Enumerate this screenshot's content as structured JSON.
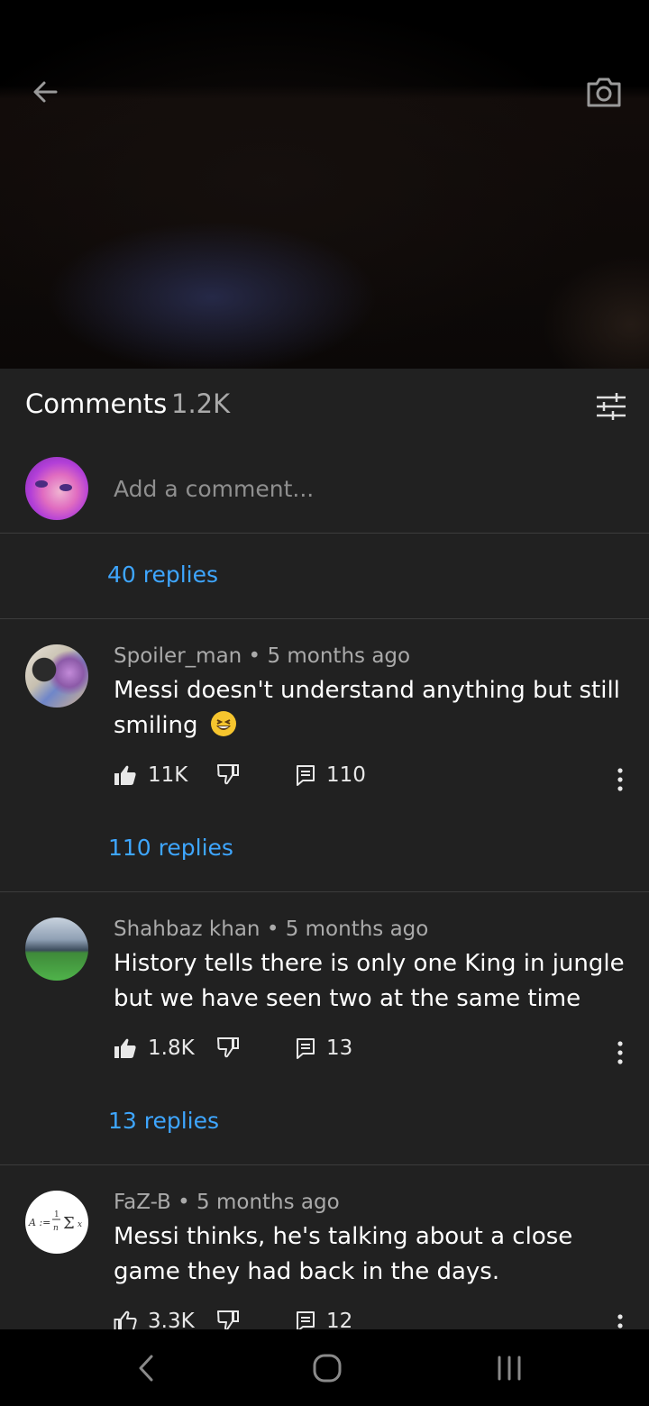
{
  "header": {
    "title": "Comments",
    "count": "1.2K"
  },
  "add_comment": {
    "placeholder": "Add a comment..."
  },
  "top_replies_label": "40 replies",
  "comments": [
    {
      "author": "Spoiler_man",
      "time": "5 months ago",
      "text": "Messi doesn't understand anything but still smiling",
      "emoji": "grinning-squinting-face",
      "likes": "11K",
      "reply_count": "110",
      "replies_label": "110 replies"
    },
    {
      "author": "Shahbaz khan",
      "time": "5 months ago",
      "text": "History tells there is only one King in jungle but we have seen two at the same time",
      "likes": "1.8K",
      "reply_count": "13",
      "replies_label": "13 replies"
    },
    {
      "author": "FaZ-B",
      "time": "5 months ago",
      "text": "Messi thinks, he's talking about a close game they had back in the days.",
      "likes": "3.3K",
      "reply_count": "12"
    }
  ],
  "meta_separator": "•",
  "icons": {
    "back": "arrow-back-icon",
    "camera": "camera-icon",
    "filter": "filter-sliders-icon",
    "like": "thumb-up-icon",
    "dislike": "thumb-down-icon",
    "reply": "comment-icon",
    "more": "more-vertical-icon",
    "nav_back": "nav-back-icon",
    "nav_home": "nav-home-icon",
    "nav_recents": "nav-recents-icon"
  },
  "colors": {
    "background": "#212121",
    "link": "#3ea6ff",
    "secondary_text": "#aaaaaa",
    "navbar": "#000000"
  }
}
